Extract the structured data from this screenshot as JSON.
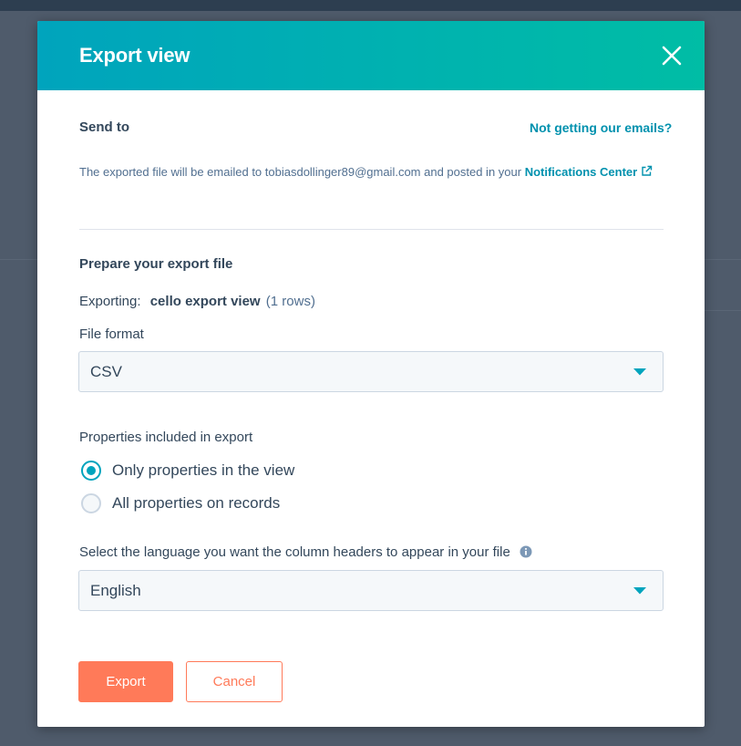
{
  "modal": {
    "title": "Export view",
    "close_icon": "close-icon"
  },
  "send_to": {
    "heading": "Send to",
    "help_link": "Not getting our emails?",
    "description_prefix": "The exported file will be emailed to tobiasdollinger89@gmail.com and posted in your ",
    "notifications_link": "Notifications Center",
    "link_icon": "external-link-icon"
  },
  "prepare": {
    "heading": "Prepare your export file",
    "exporting_label": "Exporting:",
    "view_name": "cello export view",
    "row_count": "(1 rows)"
  },
  "file_format": {
    "label": "File format",
    "selected": "CSV"
  },
  "properties": {
    "label": "Properties included in export",
    "options": [
      {
        "label": "Only properties in the view",
        "checked": true
      },
      {
        "label": "All properties on records",
        "checked": false
      }
    ]
  },
  "language": {
    "label": "Select the language you want the column headers to appear in your file",
    "info_icon": "info-icon",
    "selected": "English"
  },
  "actions": {
    "export_label": "Export",
    "cancel_label": "Cancel"
  },
  "colors": {
    "header_gradient_start": "#00a4bd",
    "header_gradient_end": "#00bda5",
    "link": "#0091ae",
    "primary_button": "#ff7a59",
    "text": "#33475b"
  }
}
